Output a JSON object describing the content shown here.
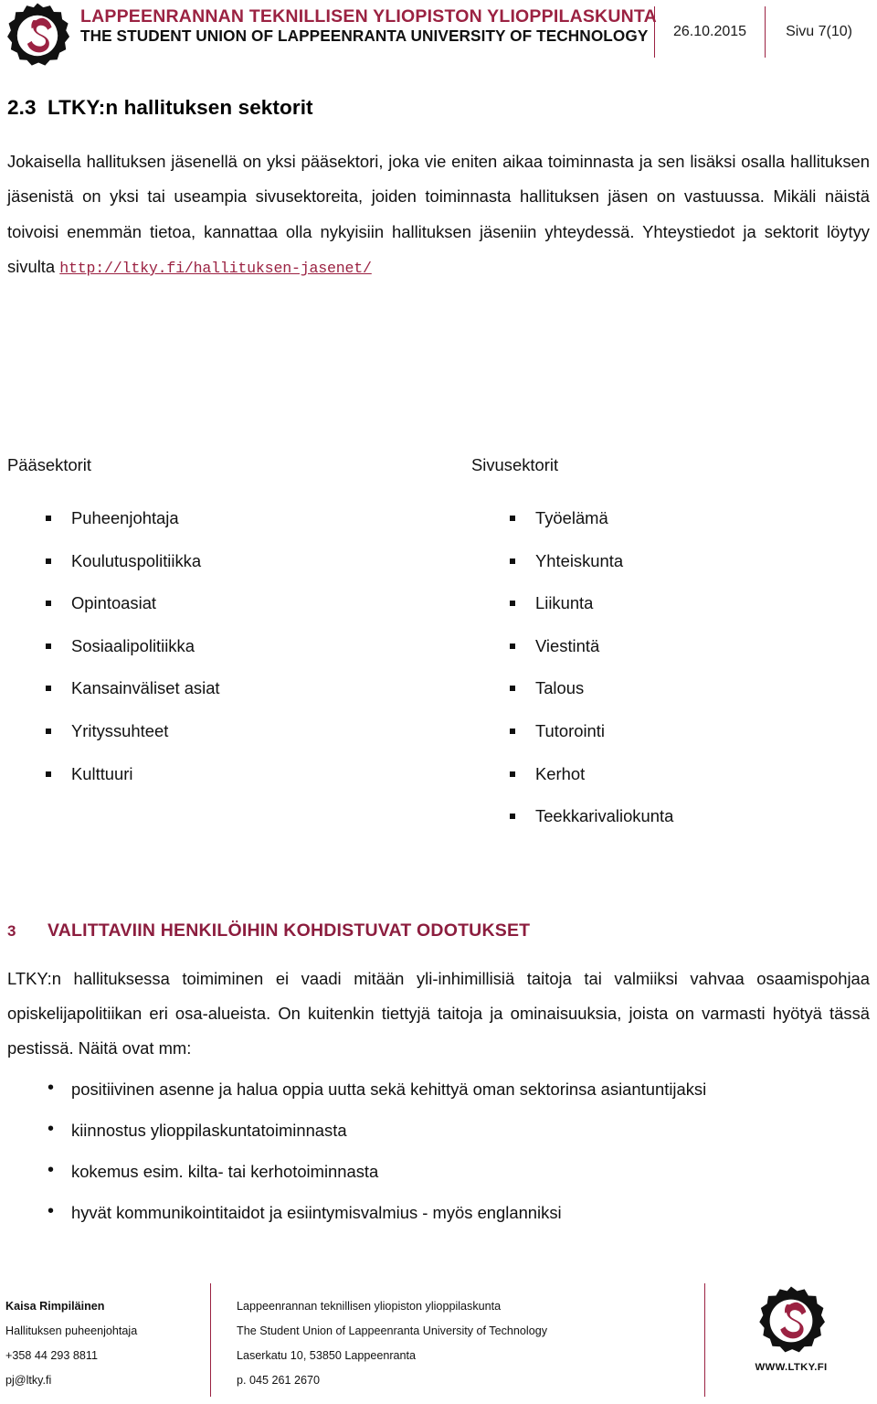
{
  "header": {
    "logo_icon": "ltky-gear-logo-icon",
    "brand_fi": "LAPPEENRANNAN TEKNILLISEN YLIOPISTON YLIOPPILASKUNTA",
    "brand_en": "THE STUDENT UNION OF LAPPEENRANTA UNIVERSITY OF TECHNOLOGY",
    "date": "26.10.2015",
    "page_label": "Sivu 7(10)",
    "accent_color": "#9B2242"
  },
  "section_2_3": {
    "number": "2.3",
    "title": "LTKY:n hallituksen sektorit",
    "paragraph_before_link": "Jokaisella hallituksen jäsenellä on yksi pääsektori, joka vie eniten aikaa toiminnasta ja sen lisäksi osalla hallituksen jäsenistä on yksi tai useampia sivusektoreita, joiden toiminnasta hallituksen jäsen on vastuussa. Mikäli näistä toivoisi enemmän tietoa, kannattaa olla nykyisiin hallituksen jäseniin yhteydessä. Yhteystiedot ja sektorit löytyy sivulta ",
    "link_text": "http://ltky.fi/hallituksen-jasenet/",
    "link_color": "#9B2242"
  },
  "sectors": {
    "main": {
      "title": "Pääsektorit",
      "items": [
        "Puheenjohtaja",
        "Koulutuspolitiikka",
        "Opintoasiat",
        "Sosiaalipolitiikka",
        "Kansainväliset asiat",
        "Yrityssuhteet",
        "Kulttuuri"
      ]
    },
    "side": {
      "title": "Sivusektorit",
      "items": [
        "Työelämä",
        "Yhteiskunta",
        "Liikunta",
        "Viestintä",
        "Talous",
        "Tutorointi",
        "Kerhot",
        "Teekkarivaliokunta"
      ]
    }
  },
  "section_3": {
    "number": "3",
    "title": "VALITTAVIIN HENKILÖIHIN KOHDISTUVAT ODOTUKSET",
    "title_color": "#8C1D3E",
    "paragraph": "LTKY:n hallituksessa toimiminen ei vaadi mitään yli-inhimillisiä taitoja tai valmiiksi vahvaa osaamispohjaa opiskelijapolitiikan eri osa-alueista. On kuitenkin tiettyjä taitoja ja ominaisuuksia, joista on varmasti hyötyä tässä pestissä. Näitä ovat mm:",
    "bullets": [
      "positiivinen asenne ja halua oppia uutta sekä kehittyä oman sektorinsa asiantuntijaksi",
      "kiinnostus ylioppilaskuntatoiminnasta",
      "kokemus esim. kilta- tai kerhotoiminnasta",
      "hyvät kommunikointitaidot ja esiintymisvalmius - myös englanniksi"
    ]
  },
  "footer": {
    "left": {
      "name": "Kaisa Rimpiläinen",
      "role": "Hallituksen puheenjohtaja",
      "phone": "+358 44 293 8811",
      "email": "pj@ltky.fi"
    },
    "middle": {
      "org_fi": "Lappeenrannan teknillisen yliopiston ylioppilaskunta",
      "org_en": "The Student Union of Lappeenranta University of Technology",
      "address": "Laserkatu 10, 53850 Lappeenranta",
      "phone": "p. 045 261 2670"
    },
    "logo_icon": "ltky-gear-logo-icon",
    "url": "WWW.LTKY.FI"
  }
}
